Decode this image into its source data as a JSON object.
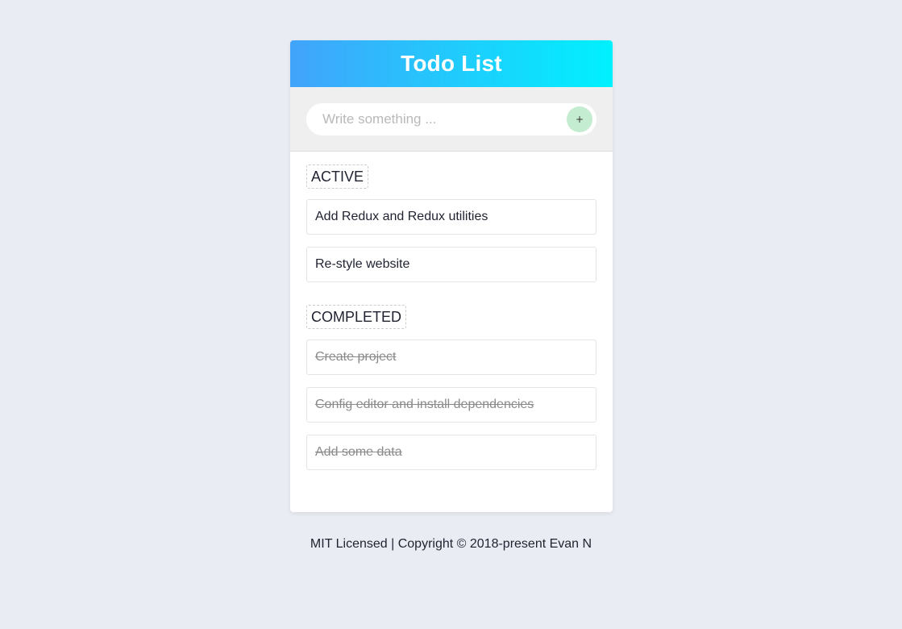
{
  "header": {
    "title": "Todo List",
    "gradient_start": "#42a3fb",
    "gradient_end": "#00f1fe"
  },
  "input": {
    "placeholder": "Write something ...",
    "value": "",
    "add_button_label": "+"
  },
  "active": {
    "label": "ACTIVE",
    "items": [
      "Add Redux and Redux utilities",
      "Re-style website"
    ]
  },
  "completed": {
    "label": "COMPLETED",
    "items": [
      "Create project",
      "Config editor and install dependencies",
      "Add some data"
    ]
  },
  "footer": {
    "text": "MIT Licensed | Copyright © 2018-present Evan N"
  }
}
